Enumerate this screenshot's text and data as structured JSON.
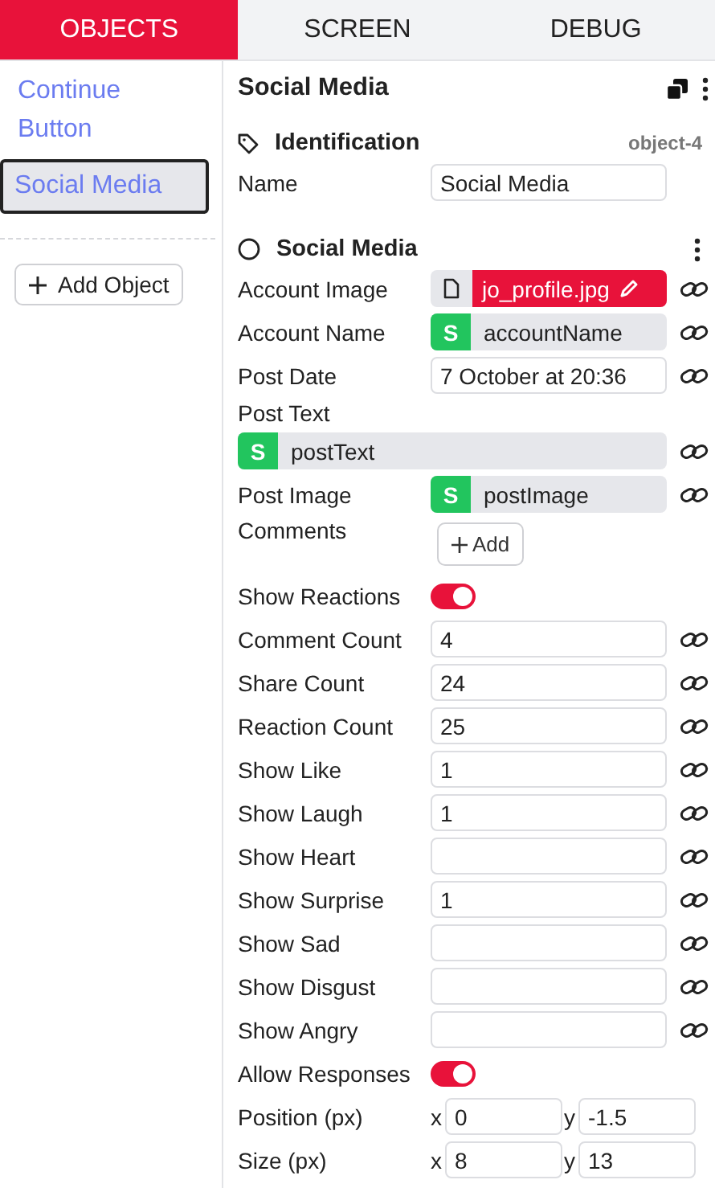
{
  "tabs": [
    {
      "label": "OBJECTS",
      "selected": true
    },
    {
      "label": "SCREEN",
      "selected": false
    },
    {
      "label": "DEBUG",
      "selected": false
    }
  ],
  "sidebar": {
    "items": [
      {
        "label": "Continue Button",
        "selected": false
      },
      {
        "label": "Social Media",
        "selected": true
      }
    ],
    "add_button": "Add Object"
  },
  "panel": {
    "title": "Social Media",
    "identification": {
      "title": "Identification",
      "id": "object-4",
      "name_label": "Name",
      "name_value": "Social Media"
    },
    "component": {
      "title": "Social Media",
      "rows": [
        {
          "kind": "file",
          "label": "Account Image",
          "value": "jo_profile.jpg",
          "link": true
        },
        {
          "kind": "binding",
          "label": "Account Name",
          "badge": "S",
          "value": "accountName",
          "link": true
        },
        {
          "kind": "text",
          "label": "Post Date",
          "value": "7 October at 20:36",
          "link": true
        },
        {
          "kind": "binding_block",
          "label": "Post Text",
          "badge": "S",
          "value": "postText",
          "link": true
        },
        {
          "kind": "binding",
          "label": "Post Image",
          "badge": "S",
          "value": "postImage",
          "link": true
        },
        {
          "kind": "add",
          "label": "Comments",
          "button": "Add"
        },
        {
          "kind": "toggle",
          "label": "Show Reactions",
          "on": true
        },
        {
          "kind": "text",
          "label": "Comment Count",
          "value": "4",
          "link": true
        },
        {
          "kind": "text",
          "label": "Share Count",
          "value": "24",
          "link": true
        },
        {
          "kind": "text",
          "label": "Reaction Count",
          "value": "25",
          "link": true
        },
        {
          "kind": "text",
          "label": "Show Like",
          "value": "1",
          "link": true
        },
        {
          "kind": "text",
          "label": "Show Laugh",
          "value": "1",
          "link": true
        },
        {
          "kind": "text",
          "label": "Show Heart",
          "link": true
        },
        {
          "kind": "text",
          "label": "Show Surprise",
          "value": "1",
          "link": true
        },
        {
          "kind": "text",
          "label": "Show Sad",
          "link": true
        },
        {
          "kind": "text",
          "label": "Show Disgust",
          "link": true
        },
        {
          "kind": "text",
          "label": "Show Angry",
          "link": true
        },
        {
          "kind": "toggle",
          "label": "Allow Responses",
          "on": true
        },
        {
          "kind": "xy",
          "label": "Position (px)",
          "x": {
            "axis": "x",
            "value": "0"
          },
          "y": {
            "axis": "y",
            "value": "-1.5"
          }
        },
        {
          "kind": "xy",
          "label": "Size (px)",
          "x": {
            "axis": "x",
            "value": "8"
          },
          "y": {
            "axis": "y",
            "value": "13"
          }
        }
      ]
    }
  }
}
